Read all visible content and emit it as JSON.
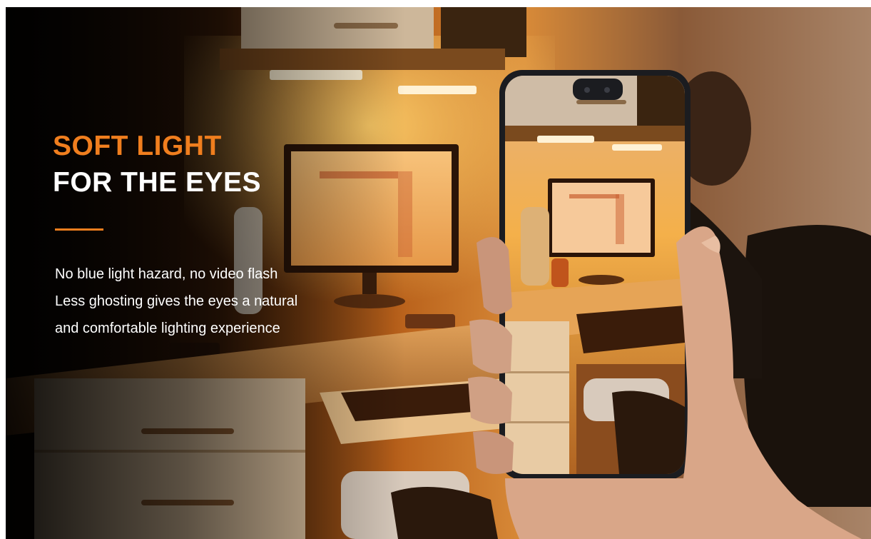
{
  "headline": {
    "accent": "SOFT LIGHT",
    "main": "FOR THE EYES"
  },
  "body": {
    "line1": "No blue light hazard, no video flash",
    "line2": "Less ghosting gives the eyes a natural",
    "line3": "and comfortable lighting experience"
  },
  "colors": {
    "accent": "#f07e1e",
    "text": "#ffffff",
    "warm_light": "#f3a43a"
  },
  "icons": {
    "phone": "smartphone",
    "hand": "hand-holding-phone"
  }
}
